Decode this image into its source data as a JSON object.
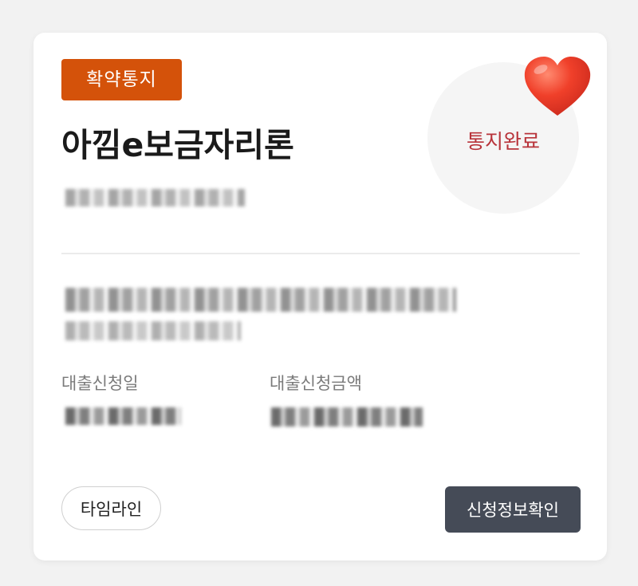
{
  "card": {
    "badge": "확약통지",
    "product_title": "아낌e보금자리론",
    "status": "통지완료",
    "status_color": "#b8333a",
    "badge_color": "#d4520a",
    "heart_icon": "red-heart-emoji"
  },
  "fields": {
    "loan_date_label": "대출신청일",
    "loan_amount_label": "대출신청금액"
  },
  "buttons": {
    "timeline": "타임라인",
    "application_info": "신청정보확인",
    "primary_color": "#454b57"
  }
}
